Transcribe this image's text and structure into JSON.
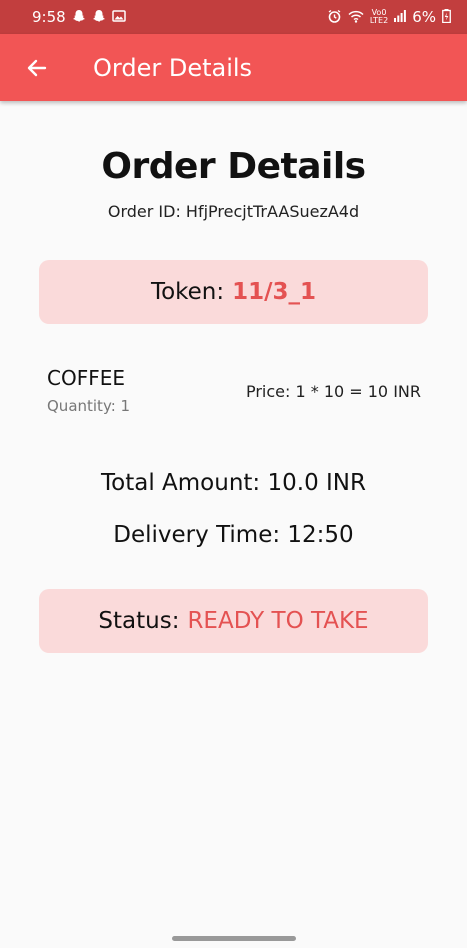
{
  "status_bar": {
    "time": "9:58",
    "network_top": "Vo0",
    "network_bottom": "LTE2",
    "battery": "6%"
  },
  "app_bar": {
    "title": "Order Details",
    "back_icon": "arrow-left-icon"
  },
  "order": {
    "heading": "Order Details",
    "order_id_label": "Order ID: HfjPrecjtTrAASuezA4d",
    "token_label": "Token:",
    "token_value": "11/3_1",
    "items": [
      {
        "name": "COFFEE",
        "quantity_label": "Quantity: 1",
        "price_label": "Price: 1 * 10 = 10 INR"
      }
    ],
    "total_label": "Total Amount: 10.0 INR",
    "delivery_label": "Delivery Time: 12:50",
    "status_label": "Status:",
    "status_value": "READY TO TAKE"
  },
  "colors": {
    "status_bar": "#c23e3e",
    "app_bar": "#f25555",
    "card_bg": "#fadada",
    "accent": "#e45252"
  }
}
